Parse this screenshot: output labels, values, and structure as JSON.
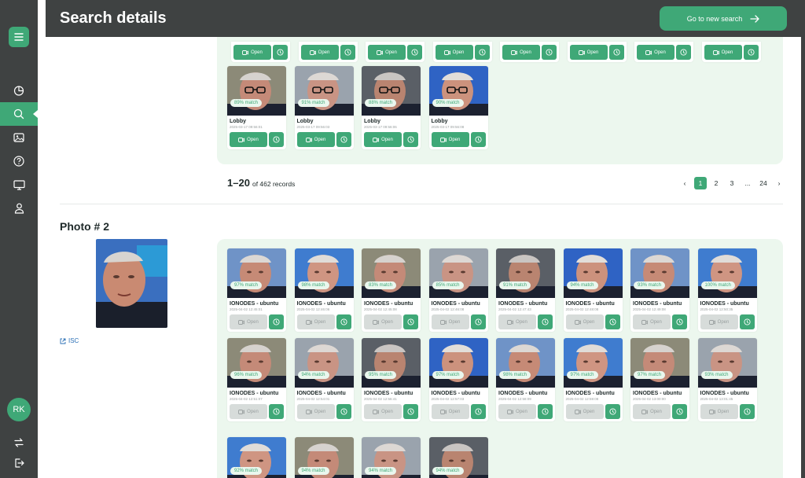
{
  "header": {
    "title": "Search details",
    "go_button": "Go to new search"
  },
  "sidebar": {
    "avatar_initials": "RK",
    "items": [
      "dashboard-icon",
      "search-icon",
      "gallery-icon",
      "help-icon",
      "monitor-icon",
      "user-icon"
    ]
  },
  "labels": {
    "open": "Open"
  },
  "top_section": {
    "cut_row_count": 8,
    "cards": [
      {
        "location": "Lobby",
        "date": "2025-03-17 09:56:01",
        "match": "89% match",
        "open_enabled": true
      },
      {
        "location": "Lobby",
        "date": "2025-03-17 09:56:03",
        "match": "91% match",
        "open_enabled": true
      },
      {
        "location": "Lobby",
        "date": "2025-03-17 09:56:06",
        "match": "88% match",
        "open_enabled": true
      },
      {
        "location": "Lobby",
        "date": "2025-03-17 09:56:08",
        "match": "90% match",
        "open_enabled": true
      }
    ],
    "pagination": {
      "range": "1–20",
      "total": "of 462 records",
      "pages": [
        "‹",
        "1",
        "2",
        "3",
        "...",
        "24",
        "›"
      ],
      "current": "1"
    }
  },
  "photo2": {
    "label": "Photo # 2",
    "link": "ISC",
    "cards": [
      {
        "location": "IONODES - ubuntu",
        "date": "2025-04-02 12:45:01",
        "match": "97% match",
        "open_enabled": false
      },
      {
        "location": "IONODES - ubuntu",
        "date": "2025-04-02 12:46:06",
        "match": "98% match",
        "open_enabled": false
      },
      {
        "location": "IONODES - ubuntu",
        "date": "2025-04-02 12:45:08",
        "match": "83% match",
        "open_enabled": false
      },
      {
        "location": "IONODES - ubuntu",
        "date": "2025-04-02 12:46:08",
        "match": "85% match",
        "open_enabled": false
      },
      {
        "location": "IONODES - ubuntu",
        "date": "2025-04-02 12:47:43",
        "match": "91% match",
        "open_enabled": false
      },
      {
        "location": "IONODES - ubuntu",
        "date": "2025-04-02 12:48:08",
        "match": "94% match",
        "open_enabled": false
      },
      {
        "location": "IONODES - ubuntu",
        "date": "2025-04-02 12:49:08",
        "match": "93% match",
        "open_enabled": false
      },
      {
        "location": "IONODES - ubuntu",
        "date": "2025-04-02 12:50:35",
        "match": "100% match",
        "open_enabled": false
      },
      {
        "location": "IONODES - ubuntu",
        "date": "2025-04-02 12:51:07",
        "match": "96% match",
        "open_enabled": false
      },
      {
        "location": "IONODES - ubuntu",
        "date": "2025-04-02 12:54:01",
        "match": "94% match",
        "open_enabled": false
      },
      {
        "location": "IONODES - ubuntu",
        "date": "2025-04-02 12:56:41",
        "match": "95% match",
        "open_enabled": false
      },
      {
        "location": "IONODES - ubuntu",
        "date": "2025-04-02 12:57:03",
        "match": "97% match",
        "open_enabled": false
      },
      {
        "location": "IONODES - ubuntu",
        "date": "2025-04-02 12:58:09",
        "match": "98% match",
        "open_enabled": false
      },
      {
        "location": "IONODES - ubuntu",
        "date": "2025-04-02 12:59:08",
        "match": "97% match",
        "open_enabled": false
      },
      {
        "location": "IONODES - ubuntu",
        "date": "2025-04-02 13:00:00",
        "match": "97% match",
        "open_enabled": false
      },
      {
        "location": "IONODES - ubuntu",
        "date": "2025-04-02 13:01:45",
        "match": "93% match",
        "open_enabled": false
      }
    ],
    "cut_cards": [
      {
        "match": "92% match"
      },
      {
        "match": "94% match"
      },
      {
        "match": "94% match"
      },
      {
        "match": "94% match"
      }
    ]
  }
}
